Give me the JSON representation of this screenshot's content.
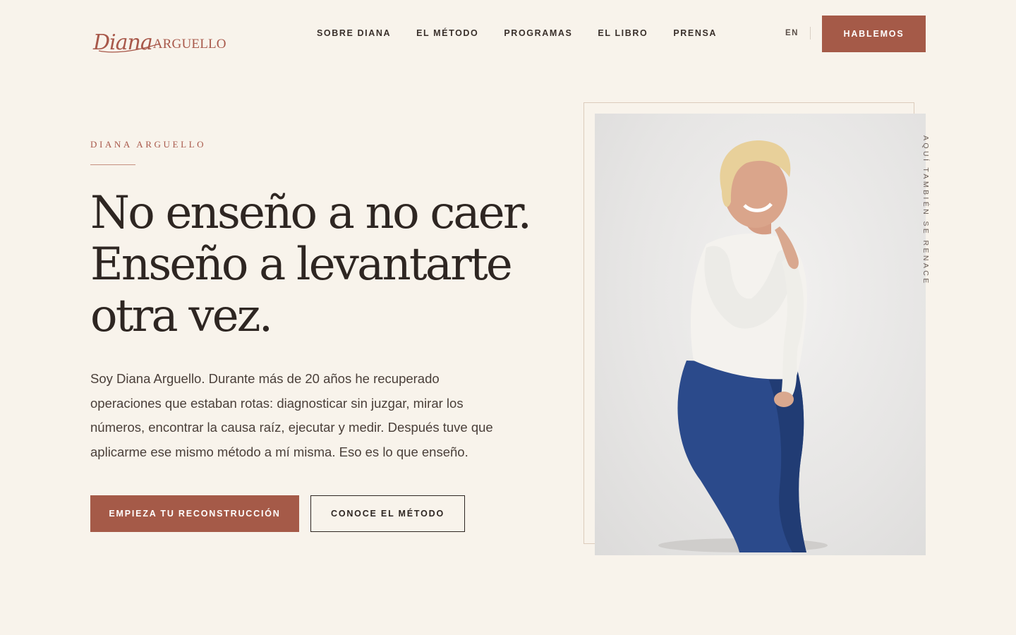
{
  "header": {
    "logo_script": "Diana",
    "logo_caps": "ARGUELLO",
    "nav": [
      {
        "label": "SOBRE DIANA"
      },
      {
        "label": "EL MÉTODO"
      },
      {
        "label": "PROGRAMAS"
      },
      {
        "label": "EL LIBRO"
      },
      {
        "label": "PRENSA"
      }
    ],
    "lang": "EN",
    "cta_label": "HABLEMOS"
  },
  "hero": {
    "eyebrow": "DIANA ARGUELLO",
    "headline_lines": [
      "No enseño a no caer.",
      "Enseño a levantarte",
      "otra vez."
    ],
    "lead": "Soy Diana Arguello. Durante más de 20 años he recuperado operaciones que estaban rotas: diagnosticar sin juzgar, mirar los números, encontrar la causa raíz, ejecutar y medir. Después tuve que aplicarme ese mismo método a mí misma. Eso es lo que enseño.",
    "primary_cta": "EMPIEZA TU RECONSTRUCCIÓN",
    "secondary_cta": "CONOCE EL MÉTODO",
    "vertical_caption": "AQUÍ TAMBIÉN SE RENACE"
  },
  "colors": {
    "background": "#f8f3eb",
    "accent": "#a55a48",
    "text": "#2e2622"
  }
}
